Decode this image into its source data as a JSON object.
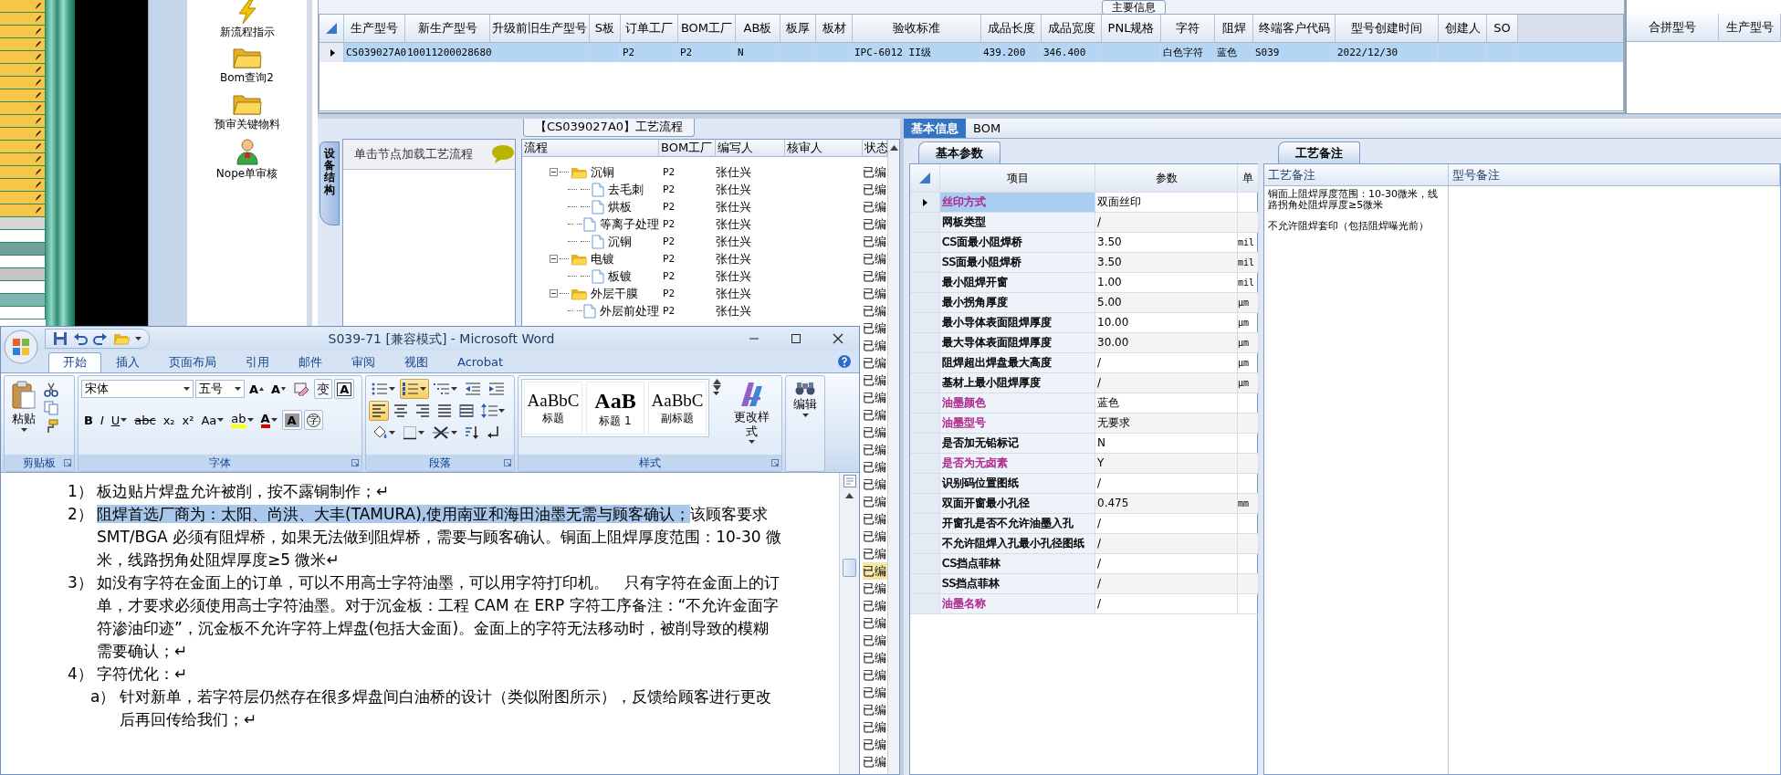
{
  "launcher": {
    "sheet_cells": [
      {
        "color": "#f7c548",
        "marked": true
      },
      {
        "color": "#f7c548",
        "marked": true
      },
      {
        "color": "#f7c548",
        "marked": true
      },
      {
        "color": "#f7c548",
        "marked": true
      },
      {
        "color": "#f7c548",
        "marked": true
      },
      {
        "color": "#f7c548",
        "marked": true
      },
      {
        "color": "#f7c548",
        "marked": true
      },
      {
        "color": "#f7c548",
        "marked": true
      },
      {
        "color": "#f7c548",
        "marked": true
      },
      {
        "color": "#f7c548",
        "marked": true
      },
      {
        "color": "#f7c548",
        "marked": true
      },
      {
        "color": "#f7c548",
        "marked": true
      },
      {
        "color": "#f7c548",
        "marked": true
      },
      {
        "color": "#f7c548",
        "marked": true
      },
      {
        "color": "#f7c548",
        "marked": true
      },
      {
        "color": "#f7c548",
        "marked": true
      },
      {
        "color": "#f7c548",
        "marked": true
      },
      {
        "color": "#d6d6d6",
        "marked": false
      },
      {
        "color": "#ffffff",
        "marked": false
      },
      {
        "color": "#6fa39a",
        "marked": false
      },
      {
        "color": "#ffffff",
        "marked": false
      },
      {
        "color": "#c4c4c4",
        "marked": false
      },
      {
        "color": "#ffffff",
        "marked": false
      },
      {
        "color": "#7fb4b0",
        "marked": false
      },
      {
        "color": "#ffffff",
        "marked": false
      }
    ],
    "tools": [
      {
        "kind": "lightning",
        "label": "新流程指示"
      },
      {
        "kind": "folder",
        "label": "Bom查询2"
      },
      {
        "kind": "folder",
        "label": "预审关键物料"
      },
      {
        "kind": "person",
        "label": "Nope单审核"
      }
    ]
  },
  "main_table": {
    "group_title": "主要信息",
    "columns": [
      "生产型号",
      "新生产型号",
      "升级前旧生产型号",
      "S板",
      "订单工厂",
      "BOM工厂",
      "AB板",
      "板厚",
      "板材",
      "验收标准",
      "成品长度",
      "成品宽度",
      "PNL规格",
      "字符",
      "阻焊",
      "终端客户代码",
      "型号创建时间",
      "创建人",
      "SO"
    ],
    "rows": [
      {
        "selected": true,
        "cells": [
          "CS039027A0",
          "10011200028680",
          null,
          null,
          "P2",
          "P2",
          "N",
          null,
          null,
          "IPC-6012 II级",
          "439.200",
          "346.400",
          null,
          "白色字符",
          "蓝色",
          "S039",
          "2022/12/30",
          null,
          null
        ]
      }
    ]
  },
  "merge_table": {
    "columns": [
      "合拼型号",
      "生产型号"
    ]
  },
  "process_panel": {
    "title": "【CS039027A0】工艺流程",
    "side_tab": "设备结构",
    "hint": "单击节点加载工艺流程",
    "columns": [
      "流程",
      "BOM工厂",
      "编写人",
      "核审人",
      "状态"
    ],
    "rows": [
      {
        "name": "沉铜",
        "kind": "folder",
        "expanded": true,
        "bom_factory": "P2",
        "writer": "张仕兴",
        "status": "已编",
        "children": [
          {
            "name": "去毛刺",
            "kind": "document",
            "bom_factory": "P2",
            "writer": "张仕兴",
            "status": "已编"
          },
          {
            "name": "烘板",
            "kind": "document",
            "bom_factory": "P2",
            "writer": "张仕兴",
            "status": "已编"
          },
          {
            "name": "等离子处理",
            "kind": "document",
            "bom_factory": "P2",
            "writer": "张仕兴",
            "status": "已编"
          },
          {
            "name": "沉铜",
            "kind": "document",
            "bom_factory": "P2",
            "writer": "张仕兴",
            "status": "已编"
          }
        ]
      },
      {
        "name": "电镀",
        "kind": "folder",
        "expanded": true,
        "bom_factory": "P2",
        "writer": "张仕兴",
        "status": "已编",
        "children": [
          {
            "name": "板镀",
            "kind": "document",
            "bom_factory": "P2",
            "writer": "张仕兴",
            "status": "已编"
          }
        ]
      },
      {
        "name": "外层干膜",
        "kind": "folder",
        "expanded": true,
        "bom_factory": "P2",
        "writer": "张仕兴",
        "status": "已编",
        "children": [
          {
            "name": "外层前处理",
            "kind": "document",
            "bom_factory": "P2",
            "writer": "张仕兴",
            "status": "已编"
          }
        ]
      }
    ],
    "more_status": [
      {
        "status": "已编",
        "selected": false
      },
      {
        "status": "已编",
        "selected": false
      },
      {
        "status": "已编",
        "selected": false
      },
      {
        "status": "已编",
        "selected": false
      },
      {
        "status": "已编",
        "selected": false
      },
      {
        "status": "已编",
        "selected": false
      },
      {
        "status": "已编",
        "selected": false
      },
      {
        "status": "已编",
        "selected": false
      },
      {
        "status": "已编",
        "selected": false
      },
      {
        "status": "已编",
        "selected": false
      },
      {
        "status": "已编",
        "selected": false
      },
      {
        "status": "已编",
        "selected": false
      },
      {
        "status": "已编",
        "selected": false
      },
      {
        "status": "已编",
        "selected": false
      },
      {
        "status": "已编",
        "selected": true
      },
      {
        "status": "已编",
        "selected": false
      },
      {
        "status": "已编",
        "selected": false
      },
      {
        "status": "已编",
        "selected": false
      },
      {
        "status": "已编",
        "selected": false
      },
      {
        "status": "已编",
        "selected": false
      },
      {
        "status": "已编",
        "selected": false
      },
      {
        "status": "已编",
        "selected": false
      },
      {
        "status": "已编",
        "selected": false
      },
      {
        "status": "已编",
        "selected": false
      },
      {
        "status": "已编",
        "selected": false
      },
      {
        "status": "已编",
        "selected": false
      }
    ]
  },
  "info_panel": {
    "tabs": [
      {
        "label": "基本信息",
        "selected": true
      },
      {
        "label": "BOM",
        "selected": false
      }
    ],
    "params": {
      "tab": "基本参数",
      "columns": [
        "项目",
        "参数",
        "单"
      ],
      "rows": [
        {
          "item": "丝印方式",
          "value": "双面丝印",
          "color": "#b0288c",
          "selected": true
        },
        {
          "item": "网板类型",
          "value": "/",
          "color": "#000000",
          "selected": false
        },
        {
          "item": "CS面最小阻焊桥",
          "value": "3.50",
          "unit": "mil",
          "color": "#000000",
          "selected": false
        },
        {
          "item": "SS面最小阻焊桥",
          "value": "3.50",
          "unit": "mil",
          "color": "#000000",
          "selected": false
        },
        {
          "item": "最小阻焊开窗",
          "value": "1.00",
          "unit": "mil",
          "color": "#000000",
          "selected": false
        },
        {
          "item": "最小拐角厚度",
          "value": "5.00",
          "unit": "μm",
          "color": "#000000",
          "selected": false
        },
        {
          "item": "最小导体表面阻焊厚度",
          "value": "10.00",
          "unit": "μm",
          "color": "#000000",
          "selected": false
        },
        {
          "item": "最大导体表面阻焊厚度",
          "value": "30.00",
          "unit": "μm",
          "color": "#000000",
          "selected": false
        },
        {
          "item": "阻焊超出焊盘最大高度",
          "value": "/",
          "unit": "μm",
          "color": "#000000",
          "selected": false
        },
        {
          "item": "基材上最小阻焊厚度",
          "value": "/",
          "unit": "μm",
          "color": "#000000",
          "selected": false
        },
        {
          "item": "油墨颜色",
          "value": "蓝色",
          "color": "#b0288c",
          "selected": false
        },
        {
          "item": "油墨型号",
          "value": "无要求",
          "color": "#b0288c",
          "selected": false
        },
        {
          "item": "是否加无铅标记",
          "value": "N",
          "color": "#000000",
          "selected": false
        },
        {
          "item": "是否为无卤素",
          "value": "Y",
          "color": "#b0288c",
          "selected": false
        },
        {
          "item": "识别码位置图纸",
          "value": "/",
          "color": "#000000",
          "selected": false
        },
        {
          "item": "双面开窗最小孔径",
          "value": "0.475",
          "unit": "mm",
          "color": "#000000",
          "selected": false
        },
        {
          "item": "开窗孔是否不允许油墨入孔",
          "value": "/",
          "color": "#000000",
          "selected": false
        },
        {
          "item": "不允许阻焊入孔最小孔径图纸",
          "value": "/",
          "color": "#000000",
          "selected": false
        },
        {
          "item": "CS挡点菲林",
          "value": "/",
          "color": "#000000",
          "selected": false
        },
        {
          "item": "SS挡点菲林",
          "value": "/",
          "color": "#000000",
          "selected": false
        },
        {
          "item": "油墨名称",
          "value": "/",
          "color": "#b0288c",
          "selected": false
        }
      ]
    },
    "notes": {
      "tab": "工艺备注",
      "columns": [
        "工艺备注",
        "型号备注"
      ],
      "paragraphs": [
        "铜面上阻焊厚度范围：10-30微米，线路拐角处阻焊厚度≥5微米",
        "不允许阻焊套印（包括阻焊曝光前）"
      ]
    }
  },
  "word": {
    "title": "S039-71 [兼容模式] - Microsoft Word",
    "quick_access": [
      {
        "kind": "save"
      },
      {
        "kind": "undo"
      },
      {
        "kind": "redo"
      },
      {
        "kind": "open"
      }
    ],
    "tabs": [
      {
        "label": "开始",
        "selected": true
      },
      {
        "label": "插入",
        "selected": false
      },
      {
        "label": "页面布局",
        "selected": false
      },
      {
        "label": "引用",
        "selected": false
      },
      {
        "label": "邮件",
        "selected": false
      },
      {
        "label": "审阅",
        "selected": false
      },
      {
        "label": "视图",
        "selected": false
      },
      {
        "label": "Acrobat",
        "selected": false
      }
    ],
    "clipboard": {
      "group": "剪贴板",
      "paste": "粘贴"
    },
    "font": {
      "group": "字体",
      "name": "宋体",
      "size": "五号",
      "rows": [
        [
          {
            "kind": "grow",
            "text": "A"
          },
          {
            "kind": "shrink",
            "text": "A"
          },
          {
            "kind": "clear"
          },
          {
            "kind": "phonetic",
            "text": "变"
          },
          {
            "kind": "boxed",
            "text": "A"
          }
        ],
        [
          {
            "kind": "bold",
            "text": "B"
          },
          {
            "kind": "italic",
            "text": "I"
          },
          {
            "kind": "underline",
            "text": "U"
          },
          {
            "kind": "strike",
            "text": "abc"
          },
          {
            "kind": "sub",
            "text": "x₂"
          },
          {
            "kind": "sup",
            "text": "x²"
          },
          {
            "kind": "case",
            "text": "Aa"
          },
          {
            "kind": "highlight",
            "text": "ab",
            "color": "#ffff00"
          },
          {
            "kind": "fontcolor",
            "text": "A",
            "color": "#e00000"
          },
          {
            "kind": "shaded",
            "text": "A"
          },
          {
            "kind": "enclosed",
            "text": "字"
          }
        ]
      ]
    },
    "paragraph": {
      "group": "段落",
      "rows": [
        [
          {
            "kind": "bullets",
            "on": false
          },
          {
            "kind": "numbering",
            "on": true
          },
          {
            "kind": "multilevel",
            "on": false
          },
          {
            "kind": "outdent",
            "on": false
          },
          {
            "kind": "indent",
            "on": false
          }
        ],
        [
          {
            "kind": "left",
            "on": true
          },
          {
            "kind": "center",
            "on": false
          },
          {
            "kind": "right",
            "on": false
          },
          {
            "kind": "justify",
            "on": false
          },
          {
            "kind": "distribute",
            "on": false
          },
          {
            "kind": "spacing",
            "on": false
          }
        ],
        [
          {
            "kind": "shading",
            "on": false
          },
          {
            "kind": "border",
            "on": false
          },
          {
            "kind": "asian",
            "on": false
          },
          {
            "kind": "sort",
            "on": false
          },
          {
            "kind": "marks",
            "on": false
          }
        ]
      ]
    },
    "styles": {
      "group": "样式",
      "gallery": [
        {
          "preview": "AaBbC",
          "label": "标题",
          "kind": "normal"
        },
        {
          "preview": "AaB",
          "label": "标题 1",
          "kind": "heading"
        },
        {
          "preview": "AaBbC",
          "label": "副标题",
          "kind": "normal"
        }
      ],
      "change": "更改样式"
    },
    "editing": {
      "group": "编辑"
    },
    "document": {
      "paragraphs": [
        {
          "marker": "1）",
          "runs": [
            {
              "text": "板边贴片焊盘允许被削，按不露铜制作；↵",
              "selected": false
            }
          ]
        },
        {
          "marker": "2）",
          "runs": [
            {
              "text": "阻焊首选厂商为：太阳、尚洪、大丰(TAMURA),使用南亚和海田油墨无需与顾客确认；",
              "selected": true
            },
            {
              "text": "该顾客要求 SMT/BGA 必须有阻焊桥，如果无法做到阻焊桥，需要与顾客确认。铜面上阻焊厚度范围：10-30 微米，线路拐角处阻焊厚度≥5 微米↵",
              "selected": false
            }
          ]
        },
        {
          "marker": "3）",
          "runs": [
            {
              "text": "如没有字符在金面上的订单，可以不用高士字符油墨，可以用字符打印机。　只有字符在金面上的订单，才要求必须使用高士字符油墨。对于沉金板：工程 CAM 在 ERP 字符工序备注：“不允许金面字符渗油印迹”，沉金板不允许字符上焊盘(包括大金面)。金面上的字符无法移动时，被削导致的模糊需要确认；↵",
              "selected": false
            }
          ]
        },
        {
          "marker": "4）",
          "runs": [
            {
              "text": "字符优化：↵",
              "selected": false
            }
          ],
          "children": [
            {
              "marker": "a）",
              "runs": [
                {
                  "text": "针对新单，若字符层仍然存在很多焊盘间白油桥的设计（类似附图所示），反馈给顾客进行更改后再回传给我们；↵",
                  "selected": false
                }
              ]
            }
          ]
        }
      ]
    }
  }
}
